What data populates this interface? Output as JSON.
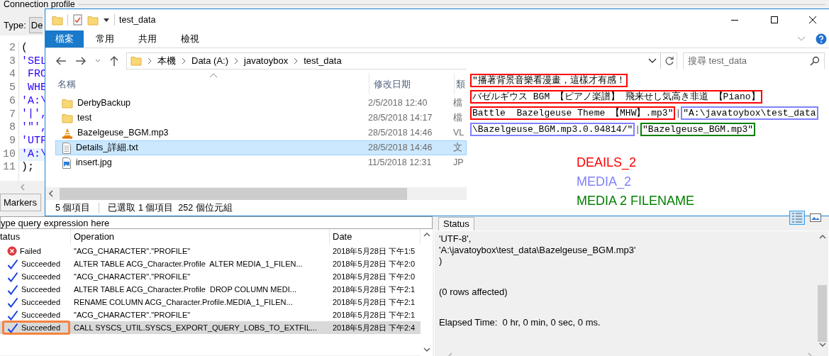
{
  "ide": {
    "connection_group": {
      "title": "Connection profile",
      "type_label": "Type:",
      "type_value": "De"
    },
    "editor_lines": [
      {
        "number": "2",
        "code": "(",
        "kind": "plain",
        "current": false
      },
      {
        "number": "3",
        "code": "'SEL",
        "kind": "string",
        "current": false
      },
      {
        "number": "4",
        "code": " FRO",
        "kind": "string",
        "current": false
      },
      {
        "number": "5",
        "code": " WHE",
        "kind": "string",
        "current": false
      },
      {
        "number": "6",
        "code": "'A:\\",
        "kind": "string",
        "current": false
      },
      {
        "number": "7",
        "code": "'|',",
        "kind": "string",
        "current": false
      },
      {
        "number": "8",
        "code": "'\"',",
        "kind": "string",
        "current": false
      },
      {
        "number": "9",
        "code": "'UTF",
        "kind": "string",
        "current": false
      },
      {
        "number": "10",
        "code": "'A:\\",
        "kind": "string",
        "current": true
      },
      {
        "number": "11",
        "code": ");",
        "kind": "plain",
        "current": false
      }
    ],
    "markers_tab": "Markers",
    "query_field": {
      "placeholder": "ype query expression here"
    },
    "history_table": {
      "columns": [
        "tatus",
        "Operation",
        "Date"
      ],
      "rows": [
        {
          "kind": "failed",
          "status": "Failed",
          "operation": "\"ACG_CHARACTER\".\"PROFILE\"",
          "date": "2018年5月28日 下午1:5",
          "selected": false,
          "outlined": false
        },
        {
          "kind": "succeeded",
          "status": "Succeeded",
          "operation": "ALTER TABLE ACG_Character.Profile  ALTER MEDIA_1_FILEN...",
          "date": "2018年5月28日 下午2:0",
          "selected": false,
          "outlined": false
        },
        {
          "kind": "succeeded",
          "status": "Succeeded",
          "operation": "\"ACG_CHARACTER\".\"PROFILE\"",
          "date": "2018年5月28日 下午2:0",
          "selected": false,
          "outlined": false
        },
        {
          "kind": "succeeded",
          "status": "Succeeded",
          "operation": "ALTER TABLE ACG_Character.Profile  DROP COLUMN MEDI...",
          "date": "2018年5月28日 下午2:1",
          "selected": false,
          "outlined": false
        },
        {
          "kind": "succeeded",
          "status": "Succeeded",
          "operation": "RENAME COLUMN ACG_Character.Profile.MEDIA_1_FILEN...",
          "date": "2018年5月28日 下午2:1",
          "selected": false,
          "outlined": false
        },
        {
          "kind": "succeeded",
          "status": "Succeeded",
          "operation": "\"ACG_CHARACTER\".\"PROFILE\"",
          "date": "2018年5月28日 下午2:1",
          "selected": false,
          "outlined": false
        },
        {
          "kind": "succeeded",
          "status": "Succeeded",
          "operation": "CALL SYSCS_UTIL.SYSCS_EXPORT_QUERY_LOBS_TO_EXTFIL...",
          "date": "2018年5月28日 下午2:4",
          "selected": true,
          "outlined": true
        }
      ]
    },
    "output_tab": "Status",
    "output_blocks": [
      [
        "'UTF-8',",
        "'A:\\javatoybox\\test_data\\Bazelgeuse_BGM.mp3'",
        ")"
      ],
      [
        "(0 rows affected)"
      ],
      [
        "Elapsed Time:  0 hr, 0 min, 0 sec, 0 ms."
      ]
    ]
  },
  "explorer": {
    "title": "test_data",
    "ribbon_tabs": [
      {
        "label": "檔案",
        "selected": true
      },
      {
        "label": "常用",
        "selected": false
      },
      {
        "label": "共用",
        "selected": false
      },
      {
        "label": "檢視",
        "selected": false
      }
    ],
    "breadcrumbs": [
      "本機",
      "Data (A:)",
      "javatoybox",
      "test_data"
    ],
    "search": {
      "placeholder": "搜尋 test_data"
    },
    "columns": [
      "名稱",
      "修改日期",
      "類"
    ],
    "files": [
      {
        "kind": "folder",
        "name": "DerbyBackup",
        "modified": "2/5/2018 12:40",
        "type": "檔",
        "selected": false
      },
      {
        "kind": "folder",
        "name": "test",
        "modified": "28/5/2018 14:17",
        "type": "檔",
        "selected": false
      },
      {
        "kind": "audio",
        "name": "Bazelgeuse_BGM.mp3",
        "modified": "28/5/2018 14:46",
        "type": "VL",
        "selected": false
      },
      {
        "kind": "text",
        "name": "Details_詳細.txt",
        "modified": "28/5/2018 14:46",
        "type": "文",
        "selected": true
      },
      {
        "kind": "image",
        "name": "insert.jpg",
        "modified": "11/5/2018 12:31",
        "type": "JP",
        "selected": false
      }
    ],
    "status_items": [
      "5 個項目",
      "已選取 1 個項目  252 個位元組"
    ],
    "view_buttons": [
      {
        "kind": "details",
        "selected": true
      },
      {
        "kind": "thumbnails",
        "selected": false
      }
    ]
  },
  "annotation": {
    "segments": [
      {
        "kind": "boxed",
        "color": "#ff0000",
        "lines": [
          "\"播著背景音樂看漫畫，這樣才有感！",
          "バゼルギウス BGM 【ピアノ楽譜】 飛来せし気高き非道 【Piano】",
          "Battle  Bazelgeuse Theme 【MHW】.mp3\""
        ]
      },
      {
        "kind": "separator",
        "text": "|"
      },
      {
        "kind": "boxed",
        "color": "#8080ff",
        "lines": [
          "\"A:\\javatoybox\\test_data",
          "\\Bazelgeuse_BGM.mp3.0.94814/\""
        ]
      },
      {
        "kind": "separator",
        "text": "|"
      },
      {
        "kind": "boxed",
        "color": "#008000",
        "lines": [
          "\"Bazelgeuse_BGM.mp3\""
        ]
      }
    ],
    "legend": [
      {
        "text": "DEAILS_2",
        "color": "#ff0000"
      },
      {
        "text": "MEDIA_2",
        "color": "#8080ff"
      },
      {
        "text": "MEDIA 2 FILENAME",
        "color": "#008000"
      }
    ]
  }
}
